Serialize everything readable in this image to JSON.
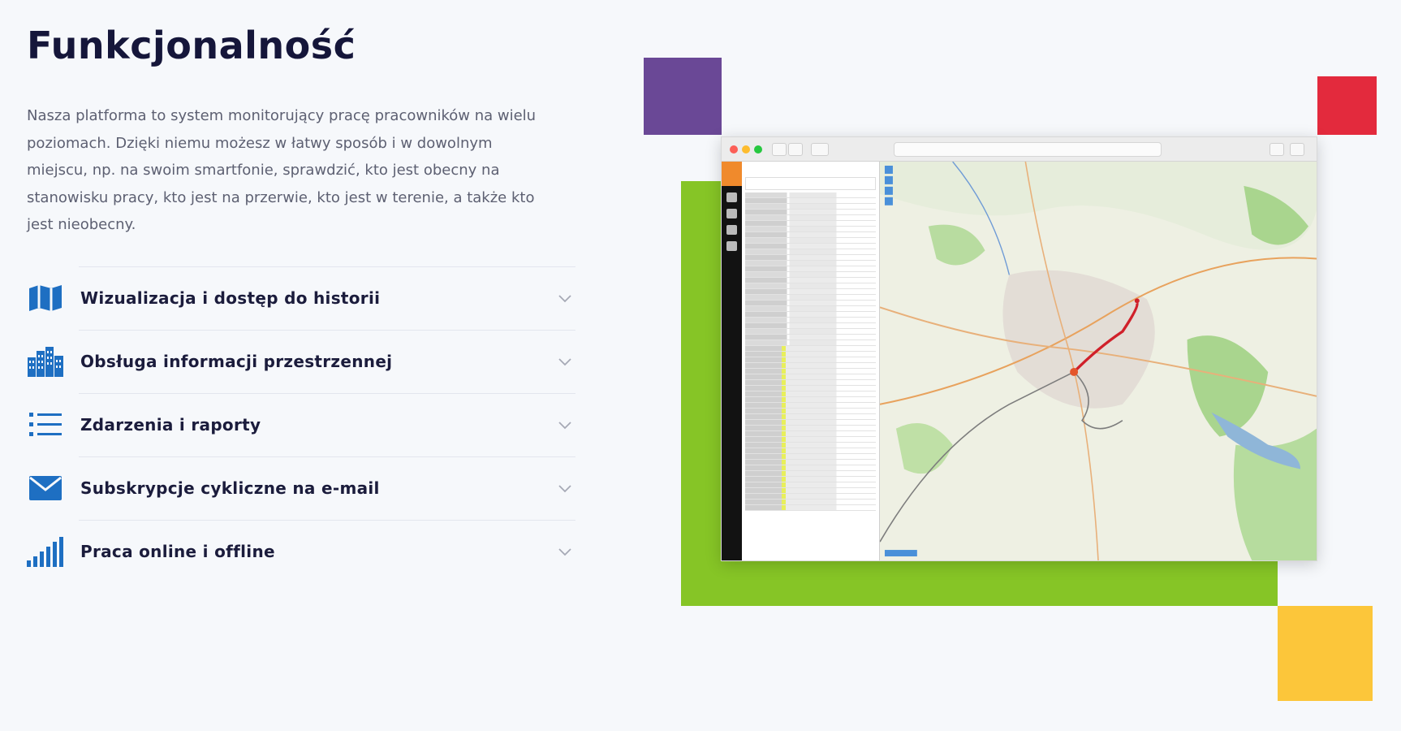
{
  "page": {
    "title": "Funkcjonalność",
    "intro": "Nasza platforma to system monitorujący pracę pracowników na wielu poziomach. Dzięki niemu możesz w łatwy sposób i w dowolnym miejscu, np. na swoim smartfonie, sprawdzić, kto jest obecny na stanowisku pracy, kto jest na przerwie, kto jest w terenie, a także kto jest nieobecny."
  },
  "features": [
    {
      "label": "Wizualizacja i dostęp do historii",
      "icon": "map-icon"
    },
    {
      "label": "Obsługa informacji przestrzennej",
      "icon": "city-icon"
    },
    {
      "label": "Zdarzenia i raporty",
      "icon": "list-icon"
    },
    {
      "label": "Subskrypcje cykliczne na e-mail",
      "icon": "envelope-icon"
    },
    {
      "label": "Praca online i offline",
      "icon": "signal-bars-icon"
    }
  ],
  "colors": {
    "accent_blue": "#1e6fc2",
    "purple": "#6a4896",
    "red": "#e32a3d",
    "green": "#86c526",
    "yellow": "#fcc63a"
  }
}
